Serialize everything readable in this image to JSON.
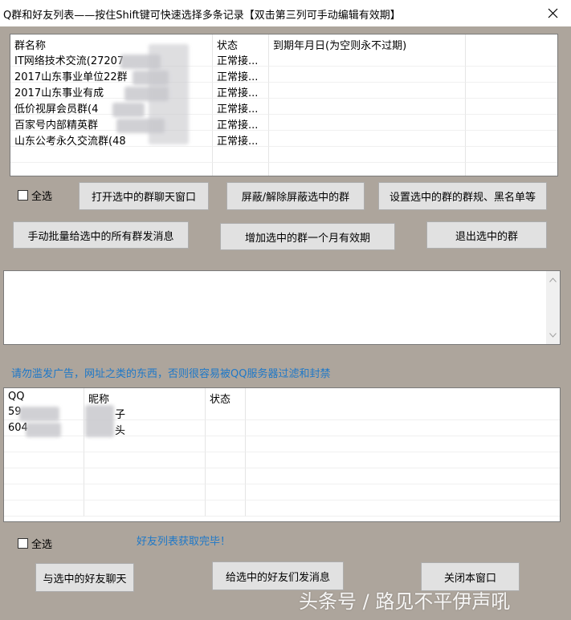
{
  "window": {
    "title": "Q群和好友列表——按住Shift键可快速选择多条记录【双击第三列可手动编辑有效期】"
  },
  "group_list": {
    "columns": [
      "群名称",
      "状态",
      "到期年月日(为空则永不过期)"
    ],
    "rows": [
      {
        "name": "IT网络技术交流(27207",
        "status": "正常接...",
        "expiry": ""
      },
      {
        "name": "2017山东事业单位22群",
        "status": "正常接...",
        "expiry": ""
      },
      {
        "name": "2017山东事业有成",
        "status": "正常接...",
        "expiry": ""
      },
      {
        "name": "低价视屏会员群(4",
        "status": "正常接...",
        "expiry": ""
      },
      {
        "name": "百家号内部精英群",
        "status": "正常接...",
        "expiry": ""
      },
      {
        "name": "山东公考永久交流群(48",
        "status": "正常接...",
        "expiry": ""
      }
    ]
  },
  "group_controls": {
    "select_all": "全选",
    "open_chat": "打开选中的群聊天窗口",
    "toggle_block": "屏蔽/解除屏蔽选中的群",
    "set_rules": "设置选中的群的群规、黑名单等",
    "bulk_message": "手动批量给选中的所有群发消息",
    "add_month": "增加选中的群一个月有效期",
    "quit_group": "退出选中的群"
  },
  "notice": "请勿滥发广告，网址之类的东西，否则很容易被QQ服务器过滤和封禁",
  "friend_list": {
    "columns": [
      "QQ",
      "昵称",
      "状态"
    ],
    "rows": [
      {
        "qq": "59",
        "nick": "子",
        "status": ""
      },
      {
        "qq": "604",
        "nick": "头",
        "status": ""
      }
    ]
  },
  "friend_controls": {
    "select_all": "全选",
    "status_text": "好友列表获取完毕！",
    "chat": "与选中的好友聊天",
    "send_message": "给选中的好友们发消息",
    "close": "关闭本窗口"
  },
  "watermark": "头条号 / 路见不平伊声吼",
  "colors": {
    "background": "#ada59c",
    "accent_text": "#1e78c8"
  }
}
